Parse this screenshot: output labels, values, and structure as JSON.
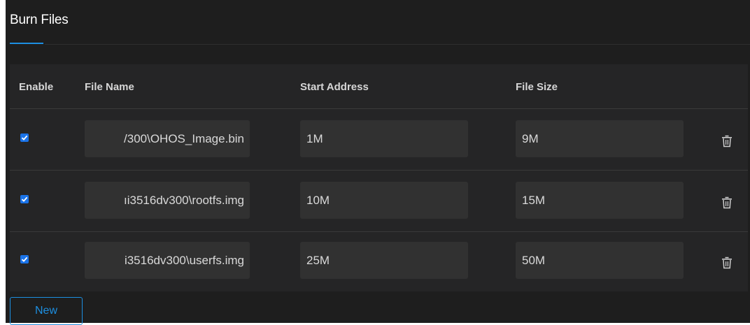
{
  "header": {
    "title": "Burn Files"
  },
  "table": {
    "columns": {
      "enable": "Enable",
      "file_name": "File Name",
      "start_address": "Start Address",
      "file_size": "File Size"
    },
    "rows": [
      {
        "enabled": true,
        "file_name": "/300\\OHOS_Image.bin",
        "start_address": "1M",
        "file_size": "9M"
      },
      {
        "enabled": true,
        "file_name": "ıi3516dv300\\rootfs.img",
        "start_address": "10M",
        "file_size": "15M"
      },
      {
        "enabled": true,
        "file_name": "i3516dv300\\userfs.img",
        "start_address": "25M",
        "file_size": "50M"
      }
    ]
  },
  "actions": {
    "new_label": "New"
  },
  "icons": {
    "row_delete": "trash-icon",
    "row_checkbox": "check-icon"
  },
  "colors": {
    "accent": "#1d8fe1",
    "checkbox": "#1a73e8",
    "background": "#1e1e1e",
    "table_bg": "#252526",
    "field_bg": "#313131"
  }
}
